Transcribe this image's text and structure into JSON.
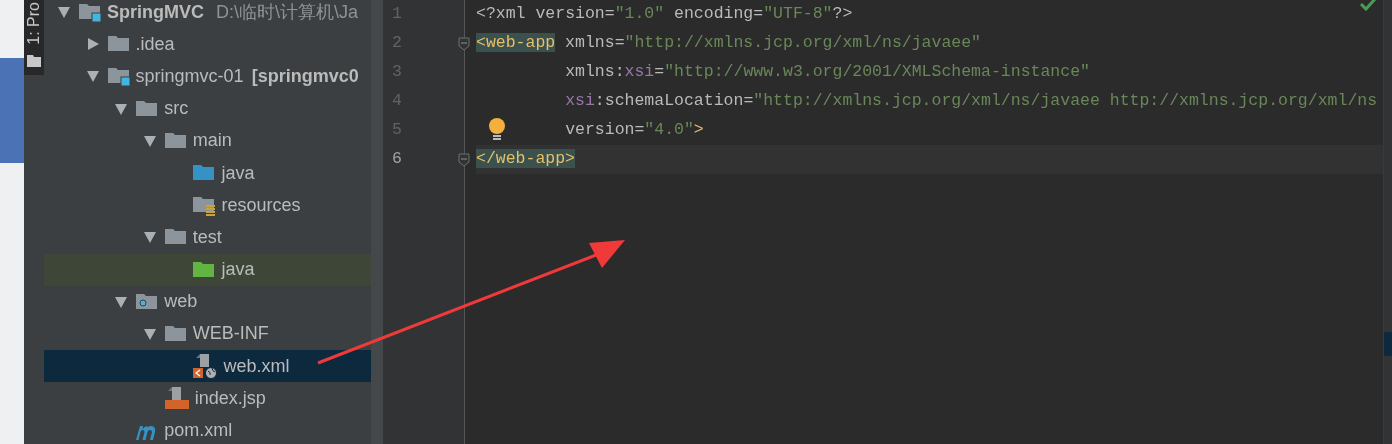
{
  "tool_window_tab": {
    "label": "1: Pro",
    "selected": true
  },
  "project_tree": [
    {
      "name": "SpringMVC",
      "path": "D:\\临时\\计算机\\Ja",
      "kind": "project",
      "expanded": true,
      "selected": false,
      "children": [
        {
          "name": ".idea",
          "kind": "folder",
          "expanded": false,
          "selected": false
        },
        {
          "name": "springmvc-01",
          "module": "[springmvc0",
          "kind": "module",
          "expanded": true,
          "selected": false,
          "children": [
            {
              "name": "src",
              "kind": "folder",
              "expanded": true,
              "selected": false,
              "children": [
                {
                  "name": "main",
                  "kind": "folder",
                  "expanded": true,
                  "selected": false,
                  "children": [
                    {
                      "name": "java",
                      "kind": "source-folder",
                      "selected": false
                    },
                    {
                      "name": "resources",
                      "kind": "resources-folder",
                      "selected": false
                    }
                  ]
                },
                {
                  "name": "test",
                  "kind": "folder",
                  "expanded": true,
                  "selected": false,
                  "children": [
                    {
                      "name": "java",
                      "kind": "test-folder",
                      "selected": false
                    }
                  ]
                }
              ]
            },
            {
              "name": "web",
              "kind": "web-folder",
              "expanded": true,
              "selected": false,
              "children": [
                {
                  "name": "WEB-INF",
                  "kind": "folder",
                  "expanded": true,
                  "selected": false,
                  "children": [
                    {
                      "name": "web.xml",
                      "kind": "xml-file",
                      "selected": true
                    }
                  ]
                },
                {
                  "name": "index.jsp",
                  "kind": "jsp-file",
                  "selected": false
                }
              ]
            },
            {
              "name": "pom.xml",
              "kind": "maven-file",
              "selected": false
            }
          ]
        }
      ]
    }
  ],
  "editor": {
    "lines": [
      {
        "number": "1",
        "current": false,
        "tokens": [
          {
            "text": "<?xml ",
            "kind": "punct"
          },
          {
            "text": "version",
            "kind": "attr"
          },
          {
            "text": "=",
            "kind": "punct"
          },
          {
            "text": "\"1.0\"",
            "kind": "value"
          },
          {
            "text": " encoding",
            "kind": "attr"
          },
          {
            "text": "=",
            "kind": "punct"
          },
          {
            "text": "\"UTF-8\"",
            "kind": "value"
          },
          {
            "text": "?>",
            "kind": "punct"
          }
        ]
      },
      {
        "number": "2",
        "current": false,
        "fold": true,
        "tokens": [
          {
            "text": "<web-app",
            "kind": "tag",
            "matched": true
          },
          {
            "text": " xmlns",
            "kind": "attr"
          },
          {
            "text": "=",
            "kind": "punct"
          },
          {
            "text": "\"http://xmlns.jcp.org/xml/ns/javaee\"",
            "kind": "value"
          }
        ]
      },
      {
        "number": "3",
        "current": false,
        "tokens": [
          {
            "text": "         xmlns:",
            "kind": "attr"
          },
          {
            "text": "xsi",
            "kind": "ns"
          },
          {
            "text": "=",
            "kind": "punct"
          },
          {
            "text": "\"http://www.w3.org/2001/XMLSchema-instance\"",
            "kind": "value"
          }
        ]
      },
      {
        "number": "4",
        "current": false,
        "tokens": [
          {
            "text": "         xsi",
            "kind": "ns"
          },
          {
            "text": ":schemaLocation",
            "kind": "attr"
          },
          {
            "text": "=",
            "kind": "punct"
          },
          {
            "text": "\"http://xmlns.jcp.org/xml/ns/javaee http://xmlns.jcp.org/xml/ns",
            "kind": "value"
          }
        ]
      },
      {
        "number": "5",
        "current": false,
        "bulb": true,
        "tokens": [
          {
            "text": "         version",
            "kind": "attr"
          },
          {
            "text": "=",
            "kind": "punct"
          },
          {
            "text": "\"4.0\"",
            "kind": "value"
          },
          {
            "text": ">",
            "kind": "tag"
          }
        ]
      },
      {
        "number": "6",
        "current": true,
        "fold": true,
        "tokens": [
          {
            "text": "</web-app>",
            "kind": "tag",
            "matched": true
          }
        ]
      }
    ]
  }
}
